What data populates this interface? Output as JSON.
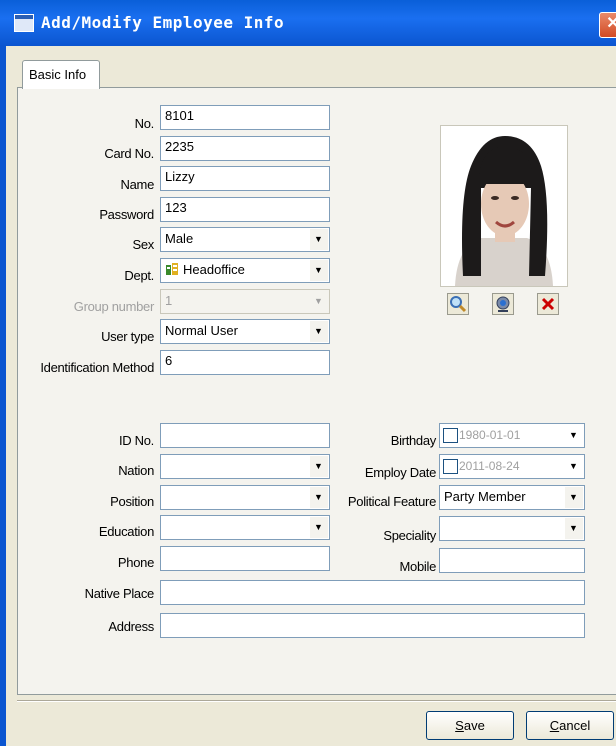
{
  "window": {
    "title": "Add/Modify Employee Info",
    "close_glyph": "✕"
  },
  "tabs": [
    {
      "label": "Basic Info"
    }
  ],
  "fields": {
    "no": {
      "label": "No.",
      "value": "8101"
    },
    "card_no": {
      "label": "Card No.",
      "value": "2235"
    },
    "name": {
      "label": "Name",
      "value": "Lizzy"
    },
    "password": {
      "label": "Password",
      "value": "123"
    },
    "sex": {
      "label": "Sex",
      "value": "Male"
    },
    "dept": {
      "label": "Dept.",
      "value": "Headoffice",
      "icon": "building-icon"
    },
    "group_number": {
      "label": "Group number",
      "value": "1"
    },
    "user_type": {
      "label": "User type",
      "value": "Normal User"
    },
    "identification_method": {
      "label": "Identification Method",
      "value": "6"
    },
    "id_no": {
      "label": "ID No.",
      "value": ""
    },
    "nation": {
      "label": "Nation",
      "value": ""
    },
    "position": {
      "label": "Position",
      "value": ""
    },
    "education": {
      "label": "Education",
      "value": ""
    },
    "phone": {
      "label": "Phone",
      "value": ""
    },
    "birthday": {
      "label": "Birthday",
      "value": "1980-01-01"
    },
    "employ_date": {
      "label": "Employ Date",
      "value": "2011-08-24"
    },
    "political_feature": {
      "label": "Political Feature",
      "value": "Party Member"
    },
    "speciality": {
      "label": "Speciality",
      "value": ""
    },
    "mobile": {
      "label": "Mobile",
      "value": ""
    },
    "native_place": {
      "label": "Native Place",
      "value": ""
    },
    "address": {
      "label": "Address",
      "value": ""
    }
  },
  "photo_tools": [
    "magnifier-icon",
    "webcam-icon",
    "delete-icon"
  ],
  "buttons": {
    "save": {
      "mnemonic": "S",
      "rest": "ave"
    },
    "cancel": {
      "mnemonic": "C",
      "rest": "ancel"
    }
  },
  "colors": {
    "titlebar": "#0a5fd8",
    "close": "#d24a24",
    "delete_icon": "#cc0000"
  }
}
